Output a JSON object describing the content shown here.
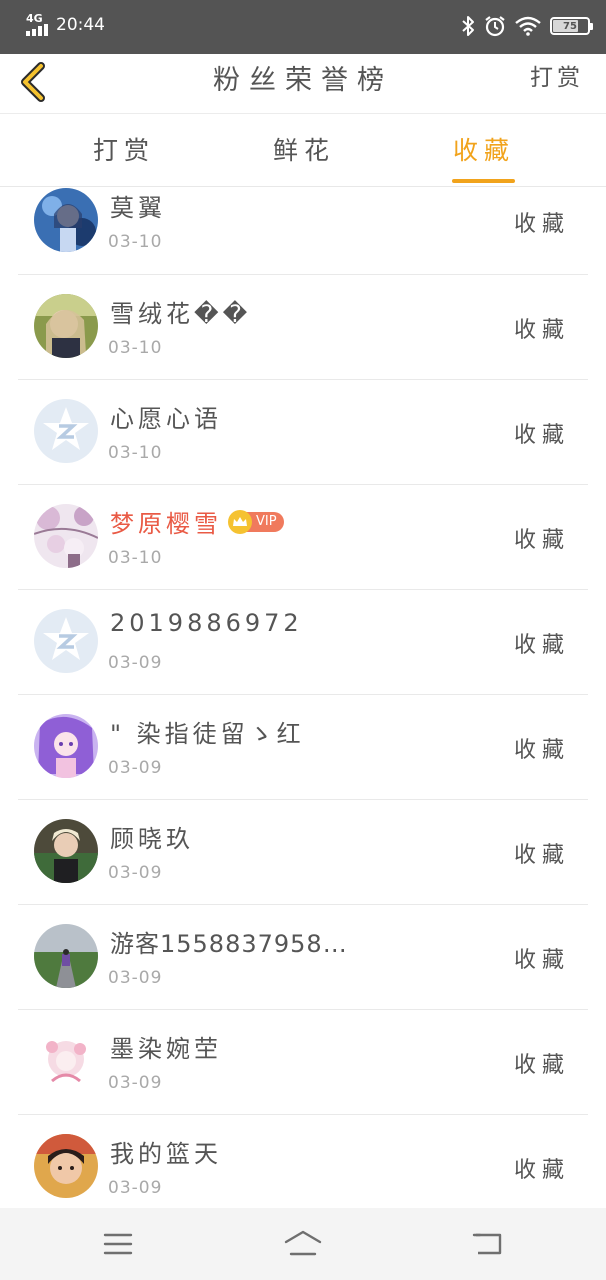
{
  "status_bar": {
    "network": "4G",
    "time": "20:44",
    "battery": "75",
    "battery_level": 0.75,
    "icons": [
      "signal-icon",
      "bluetooth-icon",
      "alarm-icon",
      "wifi-icon",
      "battery-icon"
    ]
  },
  "header": {
    "back_icon": "chevron-left-icon",
    "title": "粉丝荣誉榜",
    "right_action": "打赏"
  },
  "tabs": [
    {
      "label": "打赏",
      "active": false
    },
    {
      "label": "鲜花",
      "active": false
    },
    {
      "label": "收藏",
      "active": true
    }
  ],
  "colors": {
    "accent": "#f1a31c",
    "vip_name": "#e95a45",
    "status_bar": "#545454"
  },
  "list": {
    "items": [
      {
        "name": "莫翼",
        "date": "03-10",
        "action": "收藏",
        "avatar": "avatar-anime-blue"
      },
      {
        "name": "雪绒花��",
        "date": "03-10",
        "action": "收藏",
        "avatar": "avatar-photo-girl"
      },
      {
        "name": "心愿心语",
        "date": "03-10",
        "action": "收藏",
        "avatar": "avatar-default"
      },
      {
        "name": "梦原樱雪",
        "date": "03-10",
        "action": "收藏",
        "avatar": "avatar-blossom",
        "vip": true,
        "vip_label": "VIP"
      },
      {
        "name": "2019886972",
        "date": "03-09",
        "action": "收藏",
        "avatar": "avatar-default"
      },
      {
        "name": "\" 染指徒留ゝ红",
        "date": "03-09",
        "action": "收藏",
        "avatar": "avatar-anime-purple"
      },
      {
        "name": "顾晓玖",
        "date": "03-09",
        "action": "收藏",
        "avatar": "avatar-photo-boy"
      },
      {
        "name": "游客1558837958…",
        "date": "03-09",
        "action": "收藏",
        "avatar": "avatar-road"
      },
      {
        "name": "墨染婉茔",
        "date": "03-09",
        "action": "收藏",
        "avatar": "avatar-anime-pink"
      },
      {
        "name": "我的篮天",
        "date": "03-09",
        "action": "收藏",
        "avatar": "avatar-photo-child"
      }
    ]
  },
  "nav_bar": {
    "icons": [
      "menu-icon",
      "home-icon",
      "back-icon"
    ]
  }
}
